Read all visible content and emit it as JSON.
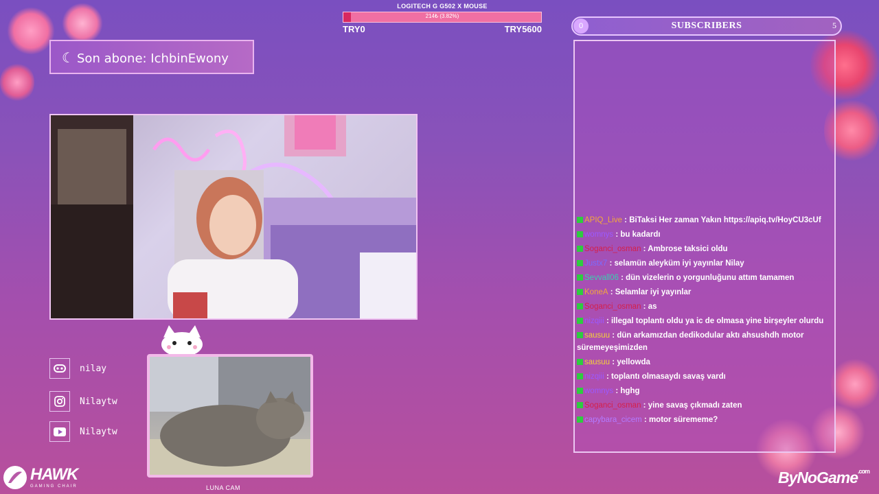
{
  "goal": {
    "title": "LOGITECH G G502 X MOUSE",
    "progress_text": "214₺ (3.82%)",
    "progress": 0.0382,
    "min_label": "TRY0",
    "max_label": "TRY5600"
  },
  "subscribers": {
    "count": "0",
    "title": "SUBSCRIBERS",
    "goal": "5"
  },
  "last_sub": {
    "text": "Son abone: IchbinEwony"
  },
  "socials": [
    {
      "icon": "discord-icon",
      "name": "nilay"
    },
    {
      "icon": "instagram-icon",
      "name": "Nilaytw"
    },
    {
      "icon": "youtube-icon",
      "name": "Nilaytw"
    }
  ],
  "cat_cam": {
    "label": "LUNA CAM"
  },
  "chat": [
    {
      "user": "APIQ_Live",
      "color": "#f4a83a",
      "text": " : BiTaksi Her zaman Yakın https://apiq.tv/HoyCU3cUf"
    },
    {
      "user": "womnys",
      "color": "#9b59ff",
      "text": " : bu kadardı"
    },
    {
      "user": "Soganci_osman",
      "color": "#d4204a",
      "text": " : Ambrose taksici oldu"
    },
    {
      "user": "Justx7",
      "color": "#7a6cff",
      "text": " : selamün aleyküm iyi yayınlar Nilay"
    },
    {
      "user": "Sevvall06",
      "color": "#37d2b0",
      "text": " : dün vizelerin o yorgunluğunu attım tamamen"
    },
    {
      "user": "KoneA",
      "color": "#f4a83a",
      "text": " : Selamlar iyi yayınlar"
    },
    {
      "user": "Soganci_osman",
      "color": "#d4204a",
      "text": " : as"
    },
    {
      "user": "nizqiii",
      "color": "#9b59ff",
      "text": " : illegal toplantı oldu ya ic de olmasa yine birşeyler olurdu"
    },
    {
      "user": "sausuu",
      "color": "#f4d03a",
      "text": " : dün arkamızdan dedikodular aktı ahsushdh motor süremeyeşimizden"
    },
    {
      "user": "sausuu",
      "color": "#f4d03a",
      "text": " : yellowda"
    },
    {
      "user": "nizqiii",
      "color": "#9b59ff",
      "text": " : toplantı olmasaydı savaş vardı"
    },
    {
      "user": "womnys",
      "color": "#9b59ff",
      "text": " : hghg"
    },
    {
      "user": "Soganci_osman",
      "color": "#d4204a",
      "text": " : yine savaş çıkmadı zaten"
    },
    {
      "user": "capybara_cicem",
      "color": "#b27bff",
      "text": " : motor sürememe?"
    }
  ],
  "logos": {
    "left_name": "HAWK",
    "left_sub": "GAMING CHAIR",
    "right_name": "ByNoGame",
    "right_suffix": ".com"
  },
  "colors": {
    "accent_pink": "#f06fa3",
    "goal_fill": "#d82860",
    "badge_green": "#2ecc40"
  }
}
